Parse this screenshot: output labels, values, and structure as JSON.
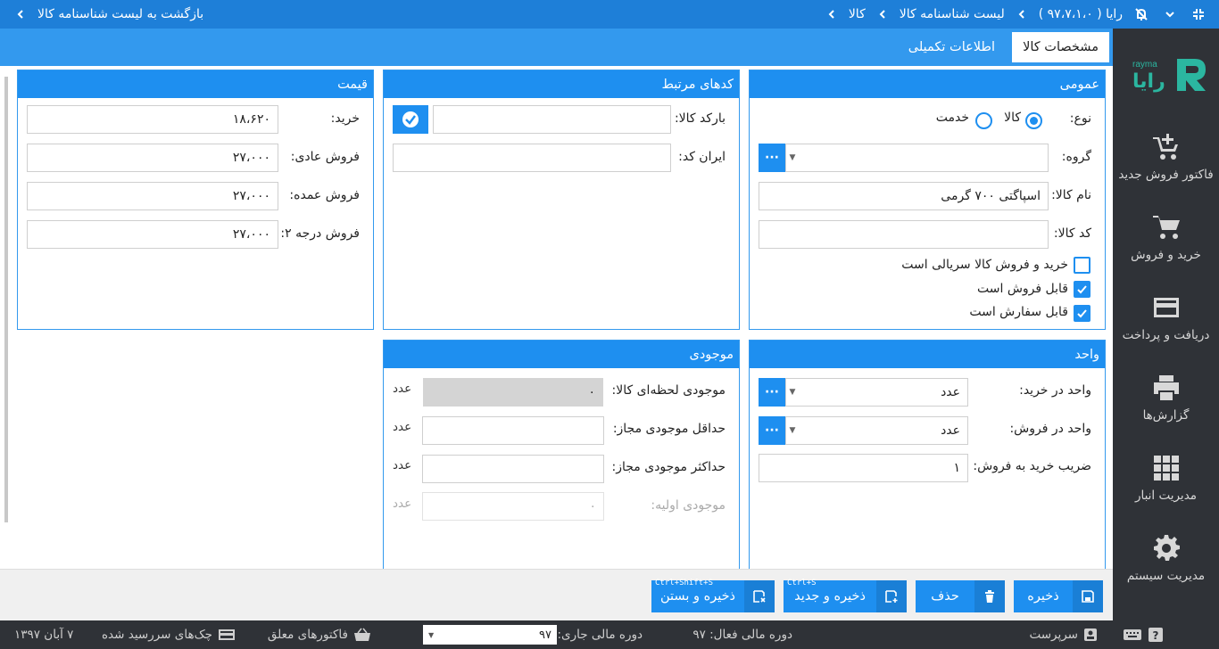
{
  "titlebar": {
    "back_label": "بازگشت به لیست شناسنامه کالا",
    "crumb_app": "رایا ( ۹۷،۷،۱،۰ )",
    "crumb_list": "لیست شناسنامه کالا",
    "crumb_item": "کالا"
  },
  "sidebar": {
    "logo_text": "رایا",
    "logo_sub": "rayma",
    "items": [
      {
        "label": "فاکتور فروش جدید",
        "icon": "cart-plus-icon"
      },
      {
        "label": "خرید و فروش",
        "icon": "cart-icon"
      },
      {
        "label": "دریافت و پرداخت",
        "icon": "credit-card-icon"
      },
      {
        "label": "گزارش‌ها",
        "icon": "printer-icon"
      },
      {
        "label": "مدیریت انبار",
        "icon": "grid-icon"
      },
      {
        "label": "مدیریت سیستم",
        "icon": "gear-icon"
      }
    ]
  },
  "tabs": {
    "specs": "مشخصات کالا",
    "extra": "اطلاعات تکمیلی"
  },
  "general": {
    "title": "عمومی",
    "type_label": "نوع:",
    "type_goods": "کالا",
    "type_service": "خدمت",
    "group_label": "گروه:",
    "group_value": "",
    "name_label": "نام کالا:",
    "name_value": "اسپاگتی ۷۰۰ گرمی",
    "code_label": "کد کالا:",
    "code_value": "",
    "chk_serial": "خرید و فروش کالا سریالی است",
    "chk_sellable": "قابل فروش است",
    "chk_orderable": "قابل سفارش است"
  },
  "codes": {
    "title": "کدهای مرتبط",
    "barcode_label": "بارکد کالا:",
    "barcode_value": "",
    "iran_label": "ایران کد:",
    "iran_value": ""
  },
  "price": {
    "title": "قیمت",
    "buy_label": "خرید:",
    "buy_value": "۱۸،۶۲۰",
    "normal_label": "فروش عادی:",
    "normal_value": "۲۷،۰۰۰",
    "wholesale_label": "فروش عمده:",
    "wholesale_value": "۲۷،۰۰۰",
    "grade2_label": "فروش درجه ۲:",
    "grade2_value": "۲۷،۰۰۰"
  },
  "unit": {
    "title": "واحد",
    "buy_unit_label": "واحد در خرید:",
    "buy_unit_value": "عدد",
    "sell_unit_label": "واحد در فروش:",
    "sell_unit_value": "عدد",
    "ratio_label": "ضریب خرید به فروش:",
    "ratio_value": "۱"
  },
  "stock": {
    "title": "موجودی",
    "current_label": "موجودی لحظه‌ای کالا:",
    "current_value": "۰",
    "min_label": "حداقل موجودی مجاز:",
    "min_value": "",
    "max_label": "حداکثر موجودی مجاز:",
    "max_value": "",
    "initial_label": "موجودی اولیه:",
    "initial_value": "۰",
    "unit_text": "عدد"
  },
  "actions": {
    "save": "ذخیره",
    "delete": "حذف",
    "save_new": "ذخیره و جدید",
    "save_new_shortcut": "Ctrl+S",
    "save_close": "ذخیره و بستن",
    "save_close_shortcut": "Ctrl+Shift+S"
  },
  "statusbar": {
    "user": "سرپرست",
    "active_period": "دوره مالی فعال: ۹۷",
    "current_period_label": "دوره مالی جاری:",
    "current_period_value": "۹۷",
    "pending_invoices": "فاکتورهای معلق",
    "due_cheques": "چک‌های سررسید شده",
    "date": "۷ آبان ۱۳۹۷"
  },
  "colors": {
    "accent": "#1e8ff0",
    "titlebar": "#1e7fd8",
    "sidebar": "#2f3237",
    "logo_green": "#2bb6a0"
  }
}
